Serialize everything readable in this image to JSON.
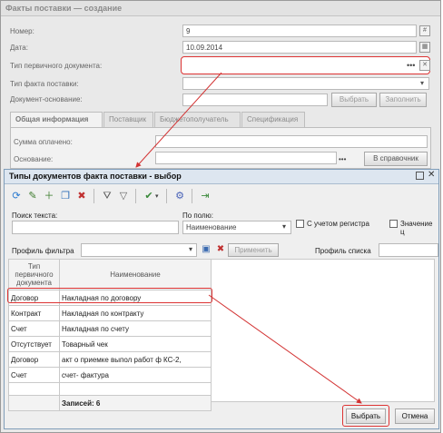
{
  "outer": {
    "title": "Факты поставки — создание",
    "fields": {
      "nomer_label": "Номер:",
      "nomer_value": "9",
      "data_label": "Дата:",
      "data_value": "10.09.2014",
      "tip_perv_label": "Тип первичного документа:",
      "tip_fakta_label": "Тип факта поставки:",
      "dok_osn_label": "Документ-основание:",
      "vybrat_label": "Выбрать",
      "zapolnit_label": "Заполнить"
    },
    "tabs": [
      "Общая информация",
      "Поставщик",
      "Бюджетополучатель",
      "Спецификация"
    ],
    "summa_label": "Сумма оплачено:",
    "osnovanie_label": "Основание:",
    "v_spravochnik_label": "В справочник"
  },
  "dialog": {
    "title": "Типы документов факта поставки - выбор",
    "search_label": "Поиск текста:",
    "search_value": "",
    "field_label": "По полю:",
    "field_value": "Наименование",
    "case_label": "С учетом регистра",
    "value_label": "Значение ц",
    "filter_profile_label": "Профиль фильтра",
    "apply_label": "Применить",
    "list_profile_label": "Профиль списка",
    "columns": [
      "Тип первичного документа",
      "Наименование"
    ],
    "rows": [
      {
        "type": "Договор",
        "name": "Накладная по договору"
      },
      {
        "type": "Контракт",
        "name": "Накладная по контракту"
      },
      {
        "type": "Счет",
        "name": "Накладная по счету"
      },
      {
        "type": "Отсутствует",
        "name": "Товарный чек"
      },
      {
        "type": "Договор",
        "name": "акт о приемке выпол работ ф КС-2,"
      },
      {
        "type": "Счет",
        "name": "счет- фактура"
      }
    ],
    "records_label": "Записей: 6",
    "select_label": "Выбрать",
    "cancel_label": "Отмена"
  },
  "colors": {
    "highlight": "#d33333",
    "dialog_border": "#7f9db9"
  }
}
